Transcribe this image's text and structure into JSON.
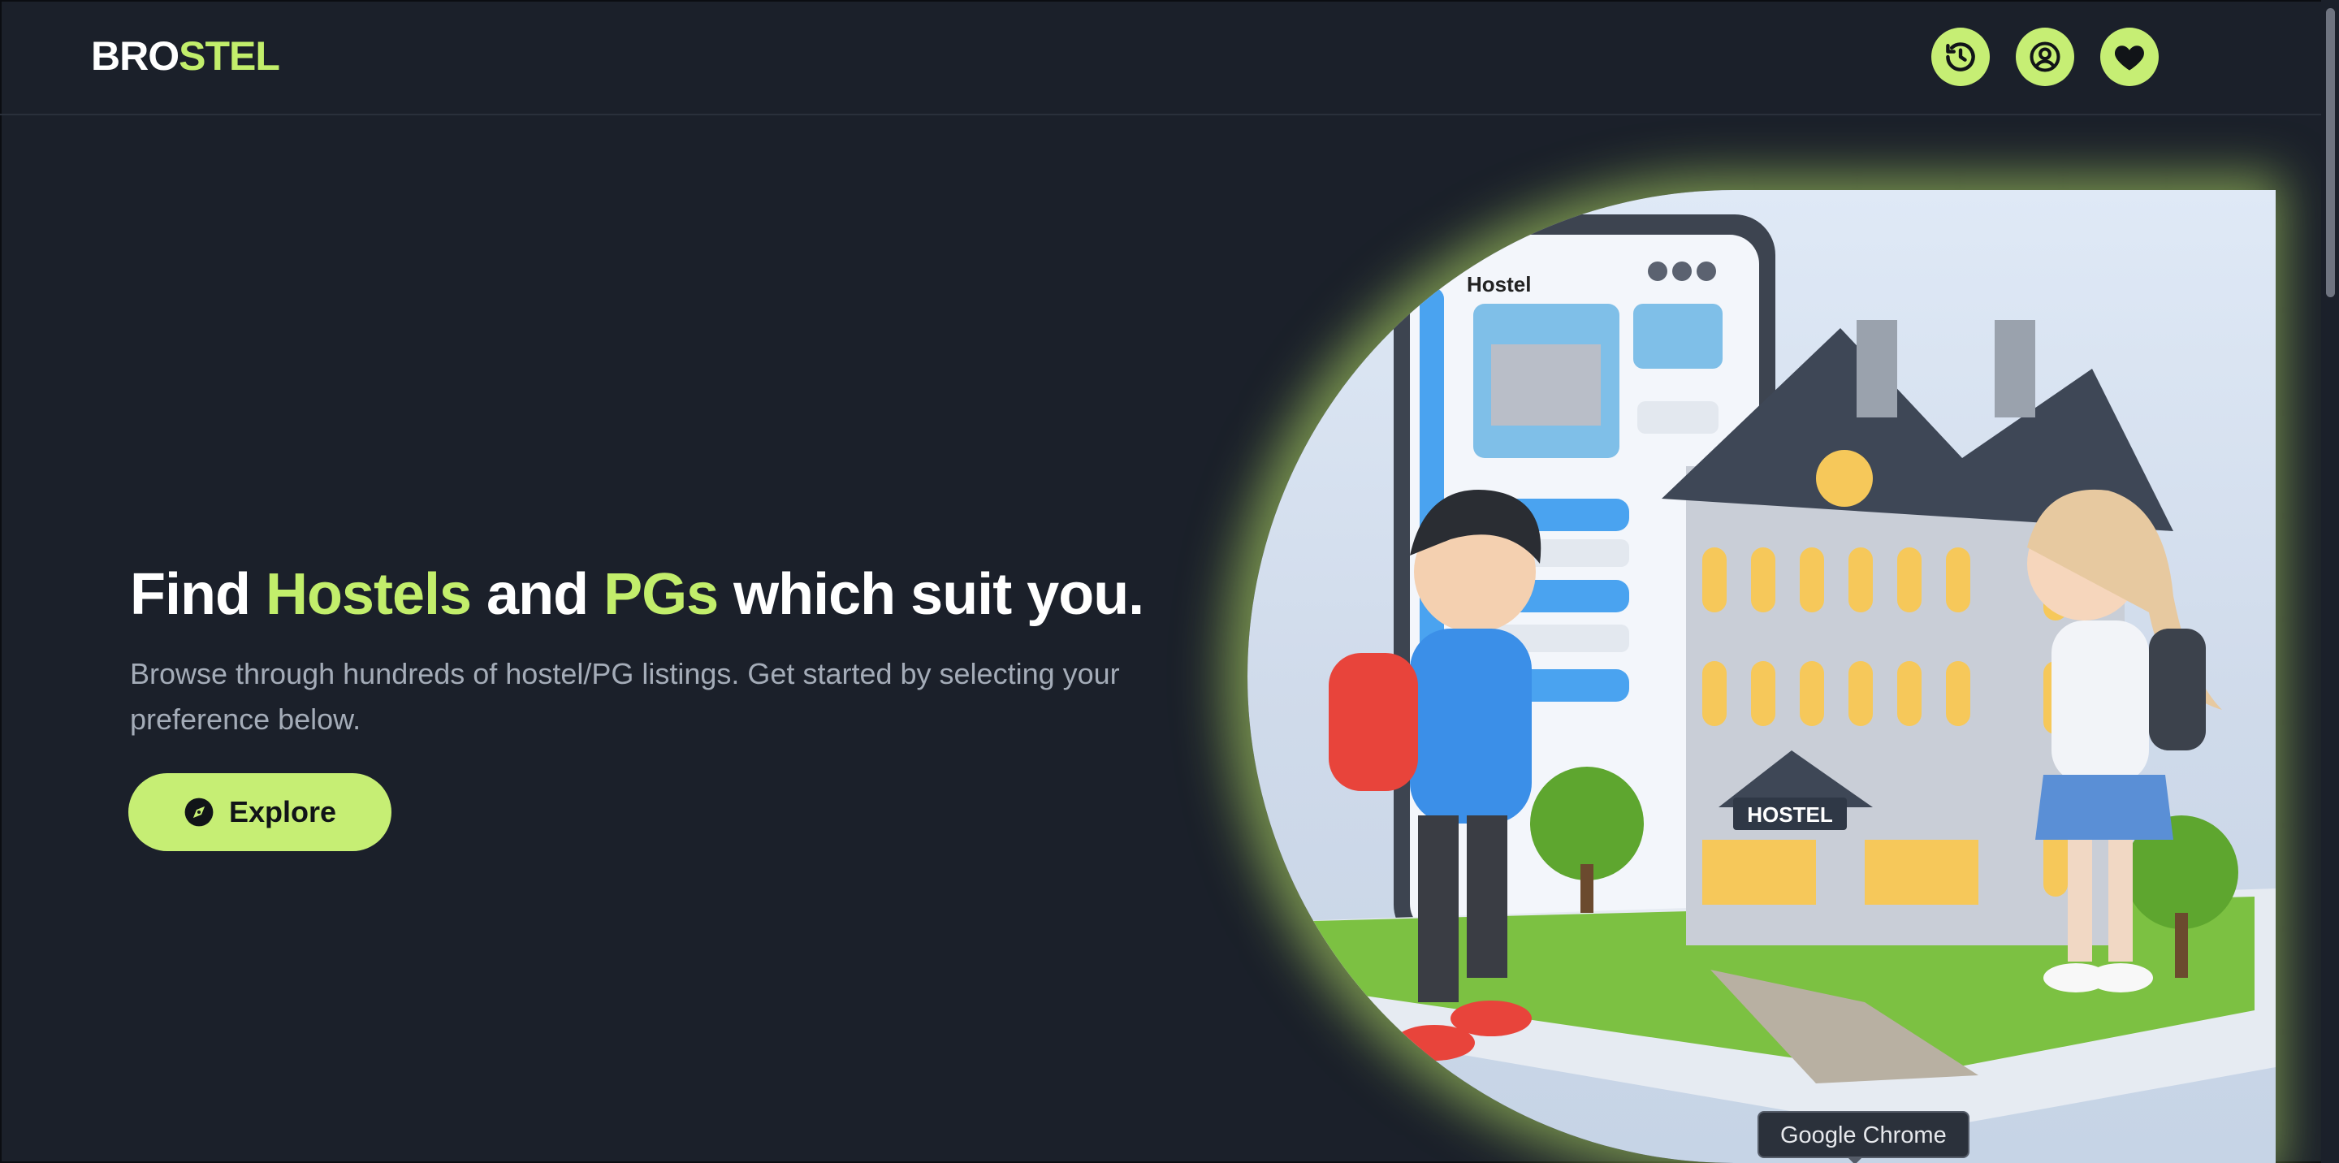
{
  "header": {
    "logo_part1": "BRO",
    "logo_part2": "STEL",
    "icons": [
      "history-icon",
      "user-circle-icon",
      "heart-icon"
    ]
  },
  "hero": {
    "title_find": "Find ",
    "title_hostels": "Hostels",
    "title_and": " and ",
    "title_pgs": "PGs",
    "title_rest": " which suit you.",
    "subtitle": "Browse through hundreds of hostel/PG listings. Get started by selecting your preference below.",
    "explore_label": "Explore"
  },
  "illustration": {
    "app_title": "Hostel",
    "building_sign": "HOSTEL"
  },
  "tooltip": {
    "text": "Google Chrome"
  },
  "colors": {
    "background": "#1b202a",
    "accent": "#c2ee6b",
    "button": "#c6ee74",
    "muted_text": "#a4acb8"
  }
}
